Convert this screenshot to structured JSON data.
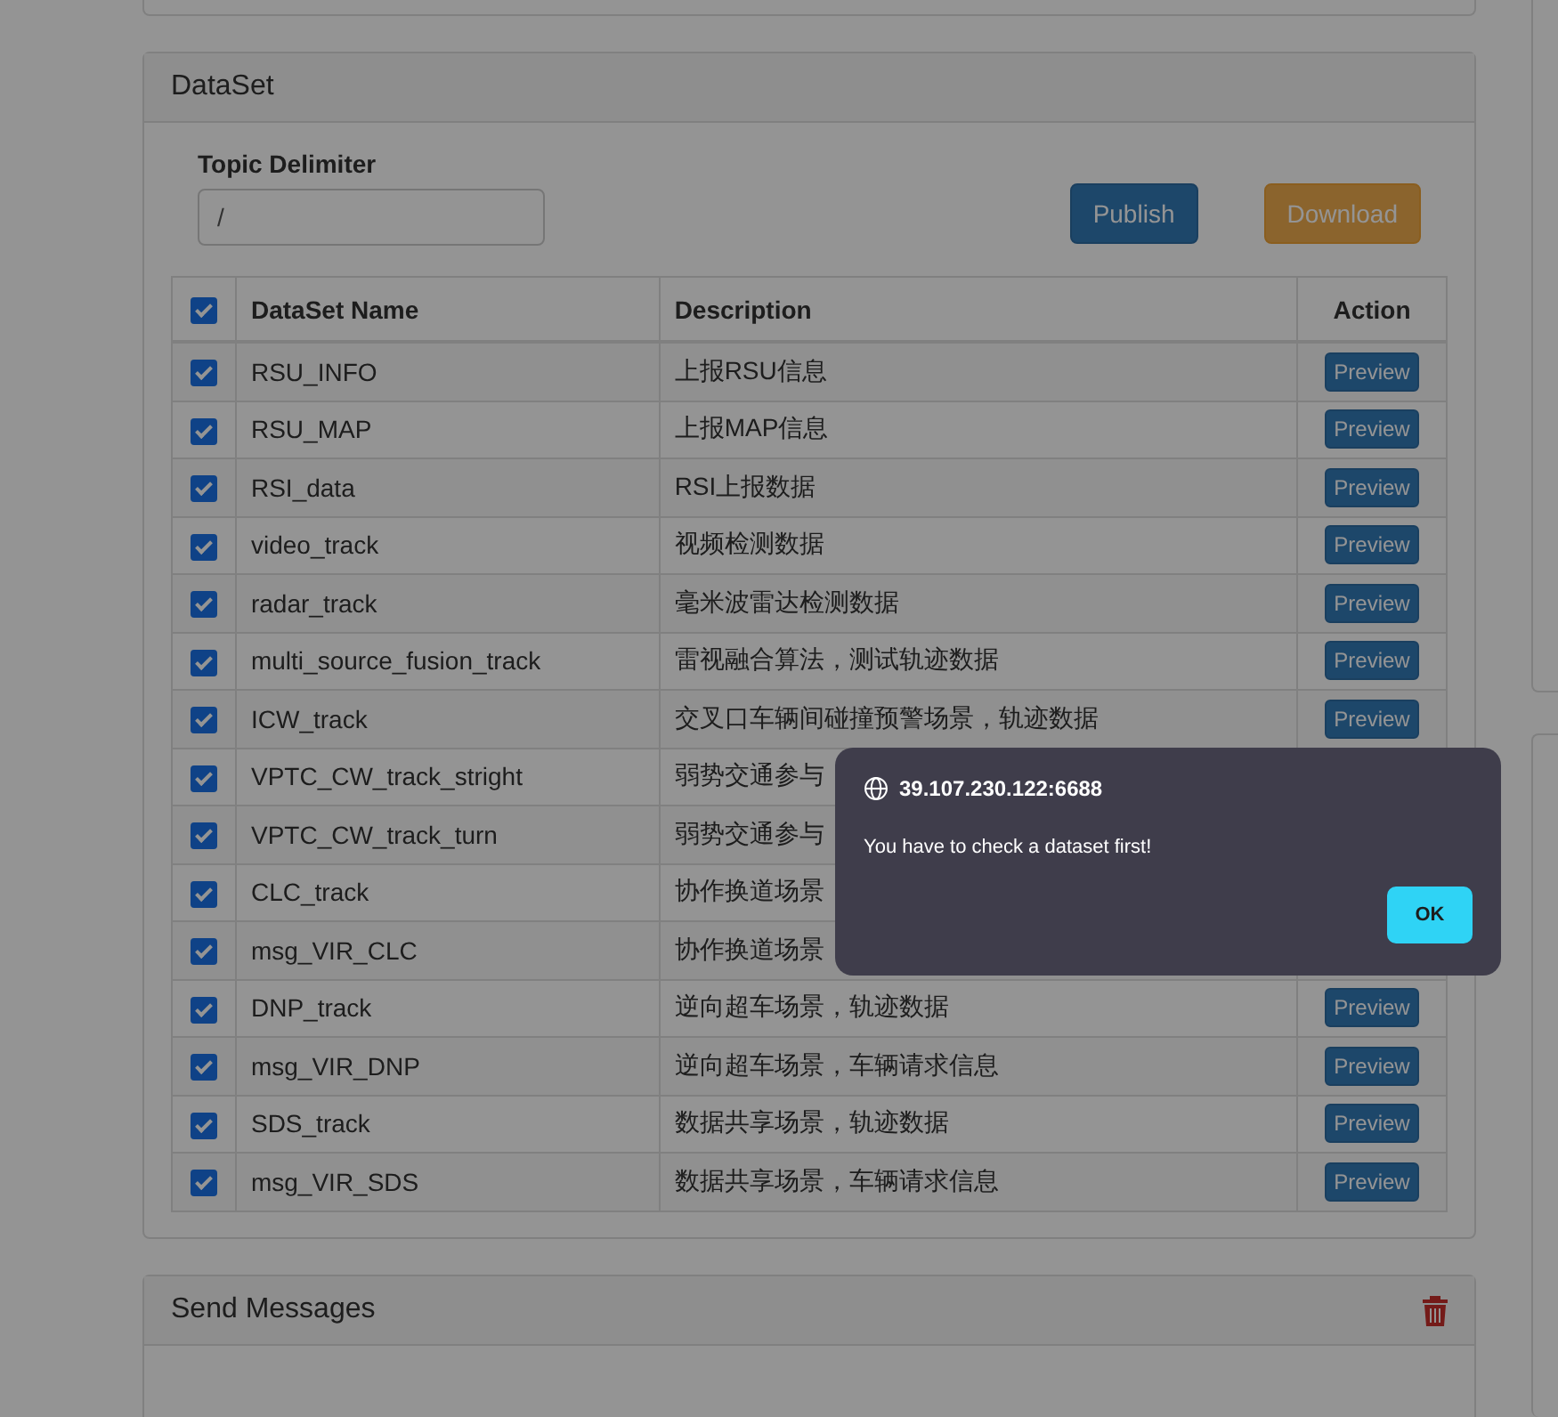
{
  "dataset": {
    "title": "DataSet",
    "delimiter_label": "Topic Delimiter",
    "delimiter_value": "/",
    "buttons": [
      {
        "kind": "primary",
        "label": "Publish"
      },
      {
        "kind": "warning",
        "label": "Download"
      }
    ],
    "table": {
      "all_checked": true,
      "columns": [
        "DataSet Name",
        "Description",
        "Action"
      ],
      "rows": [
        {
          "checked": true,
          "name": "RSU_INFO",
          "description": "上报RSU信息",
          "action": "Preview"
        },
        {
          "checked": true,
          "name": "RSU_MAP",
          "description": "上报MAP信息",
          "action": "Preview"
        },
        {
          "checked": true,
          "name": "RSI_data",
          "description": "RSI上报数据",
          "action": "Preview"
        },
        {
          "checked": true,
          "name": "video_track",
          "description": "视频检测数据",
          "action": "Preview"
        },
        {
          "checked": true,
          "name": "radar_track",
          "description": "毫米波雷达检测数据",
          "action": "Preview"
        },
        {
          "checked": true,
          "name": "multi_source_fusion_track",
          "description": "雷视融合算法，测试轨迹数据",
          "action": "Preview"
        },
        {
          "checked": true,
          "name": "ICW_track",
          "description": "交叉口车辆间碰撞预警场景，轨迹数据",
          "action": "Preview"
        },
        {
          "checked": true,
          "name": "VPTC_CW_track_stright",
          "description": "弱势交通参与"
        },
        {
          "checked": true,
          "name": "VPTC_CW_track_turn",
          "description": "弱势交通参与"
        },
        {
          "checked": true,
          "name": "CLC_track",
          "description": "协作换道场景"
        },
        {
          "checked": true,
          "name": "msg_VIR_CLC",
          "description": "协作换道场景"
        },
        {
          "checked": true,
          "name": "DNP_track",
          "description": "逆向超车场景，轨迹数据",
          "action": "Preview"
        },
        {
          "checked": true,
          "name": "msg_VIR_DNP",
          "description": "逆向超车场景，车辆请求信息",
          "action": "Preview"
        },
        {
          "checked": true,
          "name": "SDS_track",
          "description": "数据共享场景，轨迹数据",
          "action": "Preview"
        },
        {
          "checked": true,
          "name": "msg_VIR_SDS",
          "description": "数据共享场景，车辆请求信息",
          "action": "Preview"
        }
      ]
    }
  },
  "send_messages": {
    "title": "Send Messages"
  },
  "dialog": {
    "origin": "39.107.230.122:6688",
    "message": "You have to check a dataset first!",
    "button": "OK"
  }
}
